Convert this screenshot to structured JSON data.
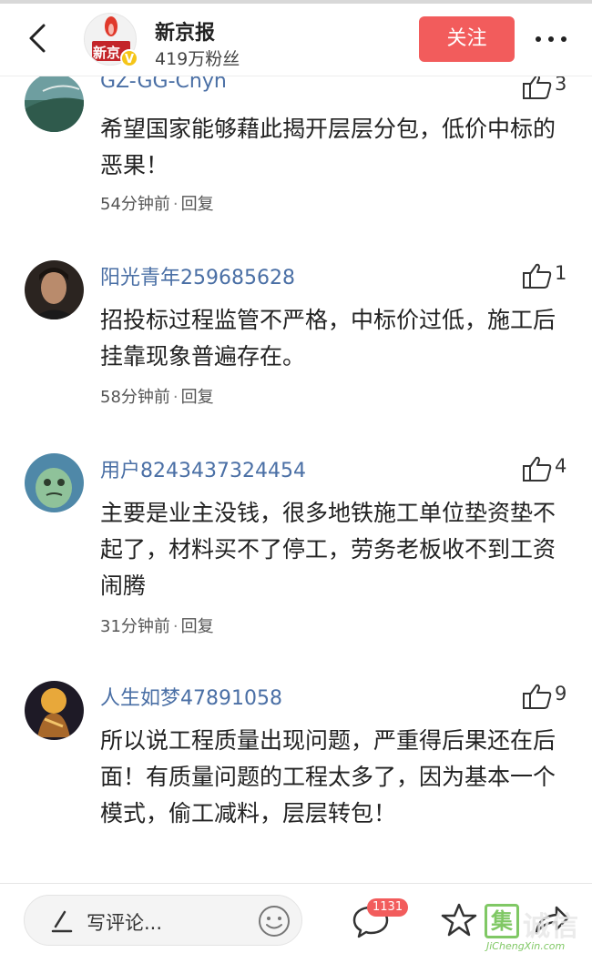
{
  "header": {
    "account_name": "新京报",
    "followers": "419万粉丝",
    "follow_label": "关注",
    "logo_text": "新京",
    "verified_mark": "V"
  },
  "comments": [
    {
      "user": "GZ-GG-Chyh",
      "likes": "3",
      "text": "希望国家能够藉此揭开层层分包，低价中标的恶果！",
      "time": "54分钟前",
      "reply": "回复"
    },
    {
      "user": "阳光青年259685628",
      "likes": "1",
      "text": "招投标过程监管不严格，中标价过低，施工后挂靠现象普遍存在。",
      "time": "58分钟前",
      "reply": "回复"
    },
    {
      "user": "用户8243437324454",
      "likes": "4",
      "text": "主要是业主没钱，很多地铁施工单位垫资垫不起了，材料买不了停工，劳务老板收不到工资闹腾",
      "time": "31分钟前",
      "reply": "回复"
    },
    {
      "user": "人生如梦47891058",
      "likes": "9",
      "text": "所以说工程质量出现问题，严重得后果还在后面！有质量问题的工程太多了，因为基本一个模式，偷工减料，层层转包！",
      "time": "",
      "reply": ""
    }
  ],
  "bottombar": {
    "comment_placeholder": "写评论...",
    "comment_count_badge": "1131"
  },
  "watermark": {
    "box_char": "集",
    "text": "诚信",
    "url": "JiChengXin.com"
  },
  "colors": {
    "accent_red": "#f25c5c",
    "username_blue": "#4a6fa5",
    "verified_yellow": "#f5c518"
  },
  "icons": [
    "back-arrow-icon",
    "more-icon",
    "thumbs-up-icon",
    "pen-icon",
    "emoji-icon",
    "chat-icon",
    "star-icon",
    "share-icon"
  ]
}
